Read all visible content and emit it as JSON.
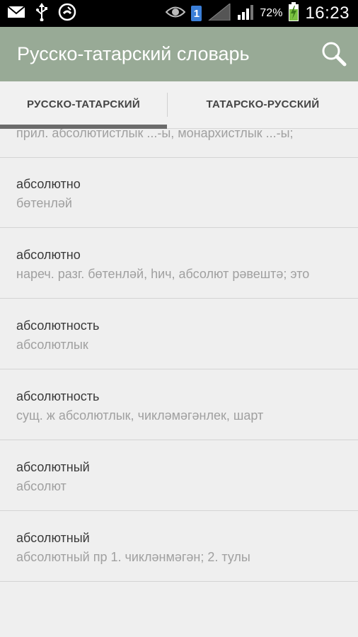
{
  "status_bar": {
    "battery_percent": "72%",
    "time": "16:23",
    "sim_slot": "1",
    "icons": [
      "mail-icon",
      "usb-icon",
      "missed-call-icon",
      "eye-icon",
      "sim-icon",
      "signal-icon",
      "signal-icon",
      "battery-charging-icon"
    ]
  },
  "action_bar": {
    "title": "Русско-татарский словарь",
    "search_icon": "search-icon"
  },
  "tabs": [
    {
      "label": "РУССКО-ТАТАРСКИЙ",
      "selected": true
    },
    {
      "label": "ТАТАРСКО-РУССКИЙ",
      "selected": false
    }
  ],
  "list": {
    "partial_top": "прил. абсолютистлык ...-ы, монархистлык ...-ы;",
    "items": [
      {
        "word": "абсолютно",
        "translation": "бөтенләй"
      },
      {
        "word": "абсолютно",
        "translation": "нареч. разг. бөтенләй, һич, абсолют рәвештә; это"
      },
      {
        "word": "абсолютность",
        "translation": "абсолютлык"
      },
      {
        "word": "абсолютность",
        "translation": "сущ. ж абсолютлык, чикләмәгәнлек, шарт"
      },
      {
        "word": "абсолютный",
        "translation": "абсолют"
      },
      {
        "word": "абсолютный",
        "translation": "абсолютный пр 1. чикләнмәгән; 2. тулы"
      }
    ]
  },
  "colors": {
    "action_bar": "#98aa96",
    "background": "#efefef",
    "tab_indicator": "#6b6b6b"
  }
}
